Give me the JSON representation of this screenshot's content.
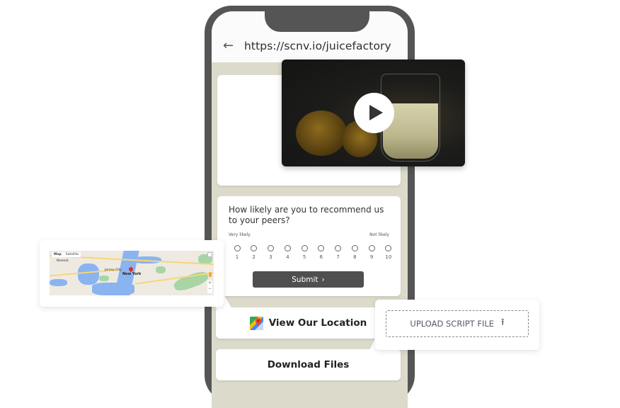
{
  "browser": {
    "url": "https://scnv.io/juicefactory",
    "back_icon": "←"
  },
  "survey": {
    "question": "How likely are you to recommend us to your peers?",
    "scale_left_label": "Very likely",
    "scale_right_label": "Not likely",
    "options": [
      "1",
      "2",
      "3",
      "4",
      "5",
      "6",
      "7",
      "8",
      "9",
      "10"
    ],
    "submit_label": "Submit",
    "submit_icon": "›"
  },
  "buttons": {
    "location_label": "View Our Location",
    "download_label": "Download Files"
  },
  "video": {
    "play_icon": "play-icon"
  },
  "map": {
    "tab_map": "Map",
    "tab_satellite": "Satellite",
    "city_label": "New York",
    "label_newark": "Newark",
    "label_jersey": "Jersey City",
    "zoom_in": "+",
    "zoom_out": "−"
  },
  "upload": {
    "label": "UPLOAD SCRIPT FILE",
    "icon": "⭱"
  }
}
